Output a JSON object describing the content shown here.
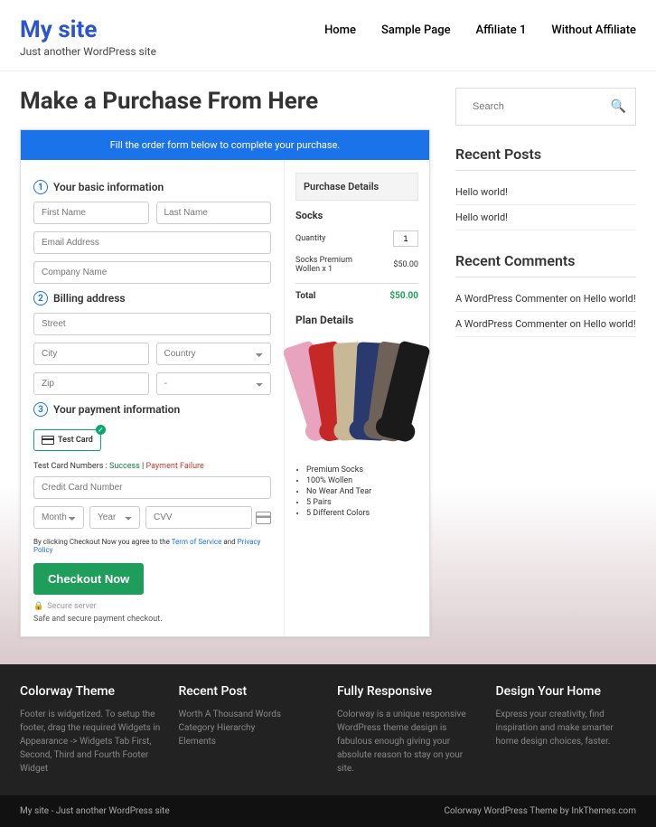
{
  "site": {
    "title": "My site",
    "tagline": "Just another WordPress site"
  },
  "nav": [
    "Home",
    "Sample Page",
    "Affiliate 1",
    "Without Affiliate"
  ],
  "page_title": "Make a Purchase From Here",
  "banner": "Fill the order form below to complete your purchase.",
  "steps": {
    "s1": "Your basic information",
    "s2": "Billing address",
    "s3": "Your payment information"
  },
  "ph": {
    "fn": "First Name",
    "ln": "Last Name",
    "em": "Email Address",
    "co": "Company Name",
    "st": "Street",
    "city": "City",
    "country": "Country",
    "zip": "Zip",
    "dash": "-",
    "cc": "Credit Card Number",
    "month": "Month",
    "year": "Year",
    "cvv": "CVV"
  },
  "card_label": "Test  Card",
  "test_line": {
    "pre": "Test Card Numbers : ",
    "suc": "Success",
    "sep": " | ",
    "fail": "Payment Failure"
  },
  "agree": {
    "pre": "By clicking Checkout Now you agree to the ",
    "tos": "Term of Service",
    "and": " and ",
    "pp": "Privacy Policy"
  },
  "checkout": "Checkout Now",
  "secure": "Secure server",
  "safe": "Safe and secure payment checkout.",
  "pd": {
    "head": "Purchase Details",
    "name": "Socks",
    "qty_l": "Quantity",
    "qty_v": "1",
    "line": "Socks Premium Wollen x 1",
    "line_p": "$50.00",
    "total_l": "Total",
    "total_v": "$50.00"
  },
  "plan_h": "Plan Details",
  "bullets": [
    "Premium Socks",
    "100% Wollen",
    "No Wear And Tear",
    "5 Pairs",
    "5 Different Colors"
  ],
  "search_ph": "Search",
  "recent_h": "Recent Posts",
  "recent": [
    "Hello world!",
    "Hello world!"
  ],
  "comments_h": "Recent Comments",
  "comments": [
    {
      "a": "A WordPress Commenter",
      "on": " on ",
      "p": "Hello world!"
    },
    {
      "a": "A WordPress Commenter",
      "on": " on ",
      "p": "Hello world!"
    }
  ],
  "footer": {
    "c1": {
      "h": "Colorway Theme",
      "t": "Footer is widgetized. To setup the footer, drag the required Widgets in Appearance -> Widgets Tab First, Second, Third and Fourth Footer Widget"
    },
    "c2": {
      "h": "Recent Post",
      "l": [
        "Worth A Thousand Words",
        "Category Hierarchy",
        "Elements"
      ]
    },
    "c3": {
      "h": "Fully Responsive",
      "t": "Colorway is a unique responsive WordPress theme design is fabulous enough giving your absolute reason to stay on your site."
    },
    "c4": {
      "h": "Design Your Home",
      "t": "Express your creativity, find inspiration and make smarter home design choices, faster."
    }
  },
  "footbar": {
    "l": "My site - Just another WordPress site",
    "r": "Colorway WordPress Theme by InkThemes.com"
  }
}
